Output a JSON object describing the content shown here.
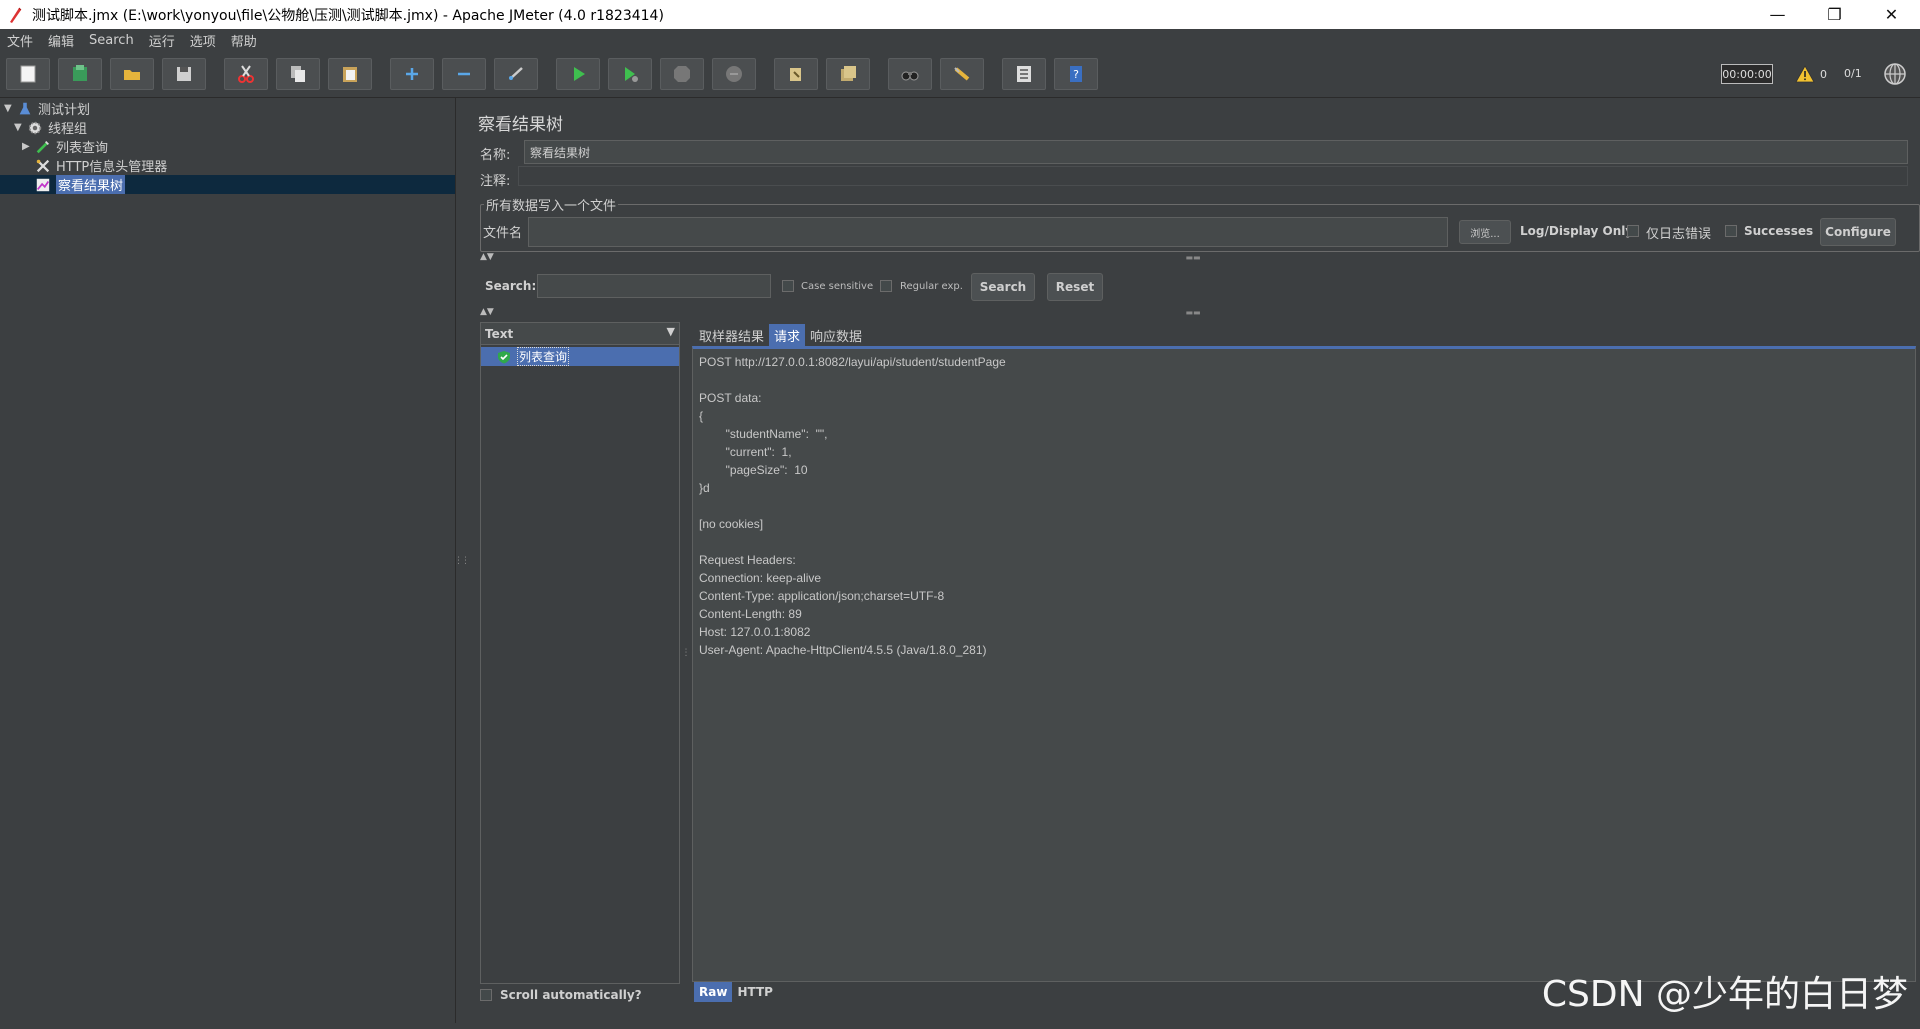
{
  "window": {
    "title": "测试脚本.jmx (E:\\work\\yonyou\\file\\公物舱\\压测\\测试脚本.jmx) - Apache JMeter (4.0 r1823414)",
    "minimize": "—",
    "maximize": "❐",
    "close": "✕"
  },
  "menu": [
    "文件",
    "编辑",
    "Search",
    "运行",
    "选项",
    "帮助"
  ],
  "toolbar": {
    "timer": "00:00:00",
    "warning_count": "0",
    "threads": "0/1"
  },
  "tree": {
    "items": [
      {
        "label": "测试计划",
        "icon": "flask-icon"
      },
      {
        "label": "线程组",
        "icon": "gear-icon"
      },
      {
        "label": "列表查询",
        "icon": "pipette-icon"
      },
      {
        "label": "HTTP信息头管理器",
        "icon": "wrench-icon"
      },
      {
        "label": "察看结果树",
        "icon": "chart-icon"
      }
    ]
  },
  "panel": {
    "title": "察看结果树",
    "name_label": "名称:",
    "name_value": "察看结果树",
    "comment_label": "注释:",
    "comment_value": "",
    "file_group_title": "所有数据写入一个文件",
    "filename_label": "文件名",
    "filename_value": "",
    "browse_label": "浏览...",
    "log_display_label": "Log/Display Only:",
    "errors_only_label": "仅日志错误",
    "successes_label": "Successes",
    "configure_label": "Configure"
  },
  "search": {
    "label": "Search:",
    "value": "",
    "case_sensitive_label": "Case sensitive",
    "regex_label": "Regular exp.",
    "search_button": "Search",
    "reset_button": "Reset"
  },
  "results": {
    "renderer": "Text",
    "items": [
      "列表查询"
    ],
    "scroll_auto_label": "Scroll automatically?"
  },
  "detail": {
    "tabs": [
      "取样器结果",
      "请求",
      "响应数据"
    ],
    "active_tab": "请求",
    "text": "POST http://127.0.0.1:8082/layui/api/student/studentPage\n\nPOST data:\n{\n        \"studentName\":  \"\",\n        \"current\":  1,\n        \"pageSize\":  10\n}d\n\n[no cookies]\n\nRequest Headers:\nConnection: keep-alive\nContent-Type: application/json;charset=UTF-8\nContent-Length: 89\nHost: 127.0.0.1:8082\nUser-Agent: Apache-HttpClient/4.5.5 (Java/1.8.0_281)",
    "bottom_tabs": [
      "Raw",
      "HTTP"
    ],
    "active_bottom_tab": "Raw"
  },
  "watermark": "CSDN @少年的白日梦"
}
